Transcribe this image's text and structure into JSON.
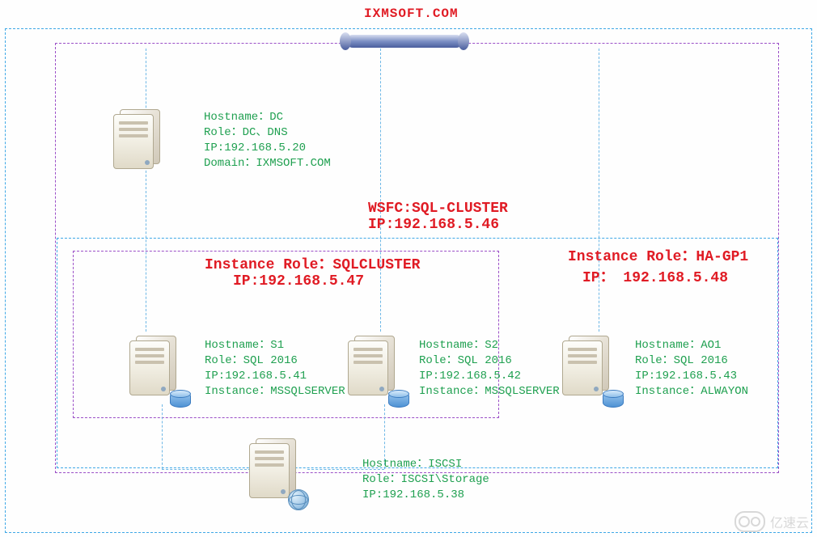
{
  "domain_title": "IXMSOFT.COM",
  "dc": {
    "line1": "Hostname：DC",
    "line2": "Role：DC、DNS",
    "line3": "IP:192.168.5.20",
    "line4": "Domain：IXMSOFT.COM"
  },
  "wsfc": {
    "line1": "WSFC:SQL-CLUSTER",
    "line2": "IP:192.168.5.46"
  },
  "sqlcluster_role": {
    "line1": "Instance Role：SQLCLUSTER",
    "line2": "IP:192.168.5.47"
  },
  "hagp1_role": {
    "line1": "Instance Role：HA-GP1",
    "line2": "IP： 192.168.5.48"
  },
  "s1": {
    "line1": "Hostname：S1",
    "line2": "Role：SQL 2016",
    "line3": "IP:192.168.5.41",
    "line4": "Instance：MSSQLSERVER"
  },
  "s2": {
    "line1": "Hostname：S2",
    "line2": "Role：SQL 2016",
    "line3": "IP:192.168.5.42",
    "line4": "Instance：MSSQLSERVER"
  },
  "ao1": {
    "line1": "Hostname：AO1",
    "line2": "Role：SQL 2016",
    "line3": "IP:192.168.5.43",
    "line4": "Instance：ALWAYON"
  },
  "iscsi": {
    "line1": "Hostname：ISCSI",
    "line2": "Role：ISCSI\\Storage",
    "line3": "IP:192.168.5.38"
  },
  "watermark": "亿速云",
  "chart_data": {
    "type": "network-topology",
    "domain": "IXMSOFT.COM",
    "wsfc_cluster": {
      "name": "SQL-CLUSTER",
      "ip": "192.168.5.46"
    },
    "instance_roles": [
      {
        "name": "SQLCLUSTER",
        "ip": "192.168.5.47",
        "members": [
          "S1",
          "S2"
        ]
      },
      {
        "name": "HA-GP1",
        "ip": "192.168.5.48",
        "members": [
          "AO1"
        ]
      }
    ],
    "nodes": [
      {
        "hostname": "DC",
        "role": "DC、DNS",
        "ip": "192.168.5.20",
        "domain": "IXMSOFT.COM"
      },
      {
        "hostname": "S1",
        "role": "SQL 2016",
        "ip": "192.168.5.41",
        "instance": "MSSQLSERVER"
      },
      {
        "hostname": "S2",
        "role": "SQL 2016",
        "ip": "192.168.5.42",
        "instance": "MSSQLSERVER"
      },
      {
        "hostname": "AO1",
        "role": "SQL 2016",
        "ip": "192.168.5.43",
        "instance": "ALWAYON"
      },
      {
        "hostname": "ISCSI",
        "role": "ISCSI\\Storage",
        "ip": "192.168.5.38"
      }
    ]
  }
}
